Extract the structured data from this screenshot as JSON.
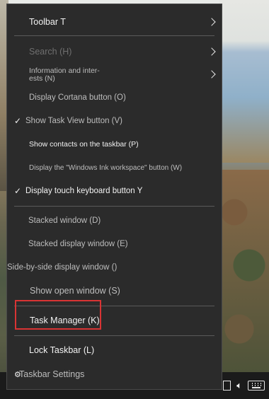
{
  "menu": {
    "toolbar": "Toolbar T",
    "search": "Search (H)",
    "info_line1": "Information and inter-",
    "info_line2": "ests (N)",
    "cortana": "Display Cortana button (O)",
    "task_view": "Show Task View button (V)",
    "contacts": "Show contacts on the taskbar (P)",
    "ink": "Display the \"Windows Ink workspace\" button (W)",
    "touch_keyboard": "Display touch keyboard button Y",
    "stacked": "Stacked window (D)",
    "stacked_display": "Stacked display window (E)",
    "side_by_side": "Side-by-side display window ()",
    "show_open": "Show open window (S)",
    "task_manager": "Task Manager (K)",
    "lock_taskbar": "Lock Taskbar (L)",
    "taskbar_settings": "Taskbar Settings",
    "check_glyph": "✓",
    "gear_glyph": "⚙"
  },
  "icons": {
    "chevron": "chevron-right-icon",
    "keyboard": "keyboard-icon",
    "volume": "volume-icon"
  },
  "colors": {
    "menu_bg": "#2b2b2b",
    "highlight": "#d83434"
  }
}
